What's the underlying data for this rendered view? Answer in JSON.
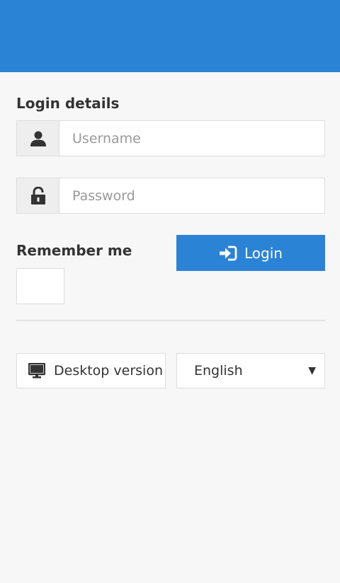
{
  "header": {
    "color": "#2b83d6"
  },
  "login": {
    "section_title": "Login details",
    "username": {
      "placeholder": "Username",
      "value": "",
      "icon": "user-icon"
    },
    "password": {
      "placeholder": "Password",
      "value": "",
      "icon": "lock-icon"
    },
    "remember_label": "Remember me",
    "remember_checked": false,
    "button_label": "Login",
    "button_icon": "sign-in-icon"
  },
  "footer": {
    "desktop_label": "Desktop version",
    "desktop_icon": "monitor-icon",
    "language": {
      "selected": "English"
    }
  },
  "colors": {
    "accent": "#2b83d6",
    "background": "#f7f7f7"
  }
}
